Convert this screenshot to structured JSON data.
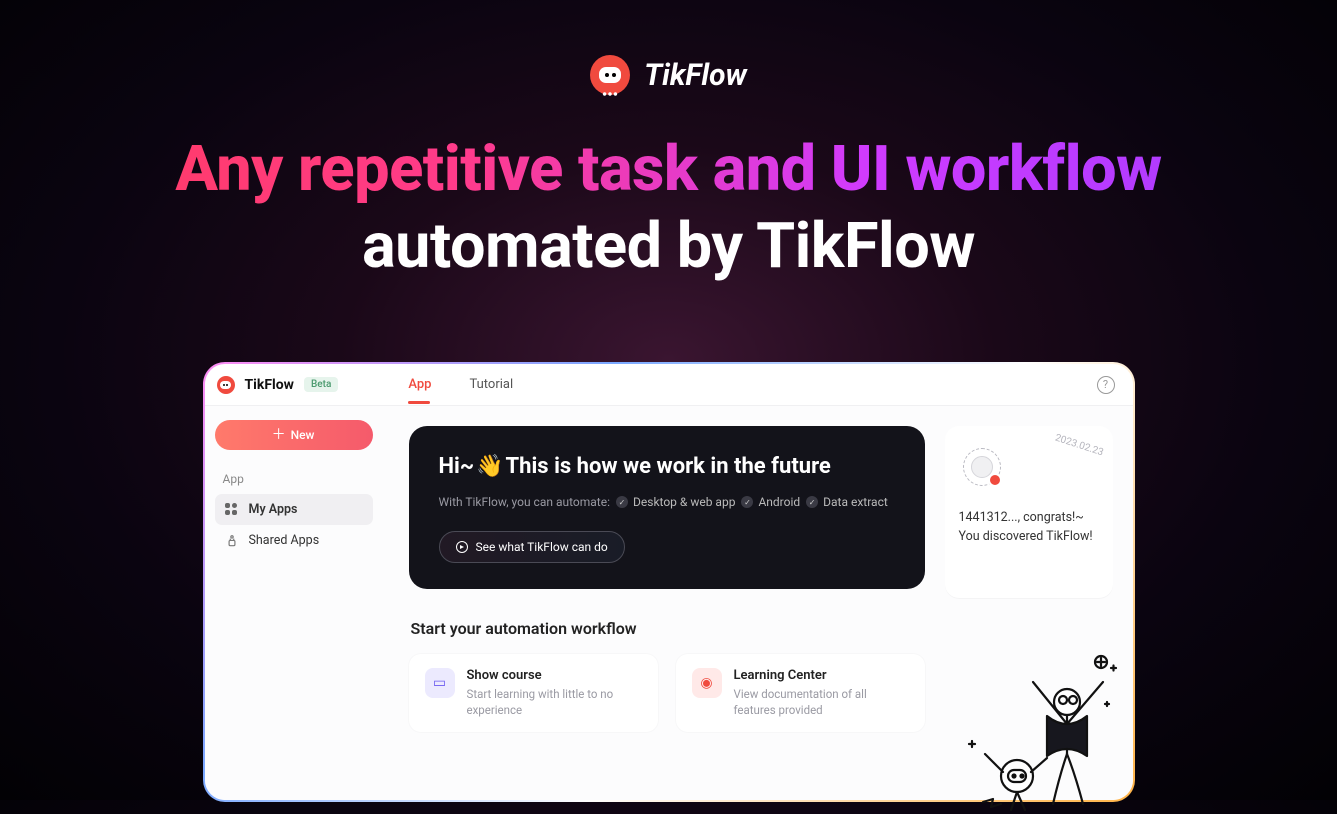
{
  "brand": {
    "name": "TikFlow"
  },
  "headline": {
    "line1": "Any repetitive task and UI workflow",
    "line2": "automated by TikFlow"
  },
  "app": {
    "topbar": {
      "title": "TikFlow",
      "badge": "Beta",
      "tabs": [
        {
          "label": "App",
          "active": true
        },
        {
          "label": "Tutorial",
          "active": false
        }
      ]
    },
    "sidebar": {
      "new_button": "New",
      "section_label": "App",
      "items": [
        {
          "label": "My Apps",
          "active": true
        },
        {
          "label": "Shared Apps",
          "active": false
        }
      ]
    },
    "hero": {
      "title_prefix": "Hi~",
      "title_emoji": "👋",
      "title_rest": "This is how we work in the future",
      "subtitle_lead": "With TikFlow, you can automate:",
      "features": [
        "Desktop & web app",
        "Android",
        "Data extract"
      ],
      "cta": "See what TikFlow can do"
    },
    "congrats": {
      "date": "2023.02.23",
      "line1": "1441312..., congrats!~",
      "line2": "You discovered TikFlow!"
    },
    "start": {
      "title": "Start your automation workflow",
      "cards": [
        {
          "title": "Show course",
          "desc": "Start learning with little to no experience"
        },
        {
          "title": "Learning Center",
          "desc": "View documentation of all features provided"
        }
      ]
    }
  }
}
